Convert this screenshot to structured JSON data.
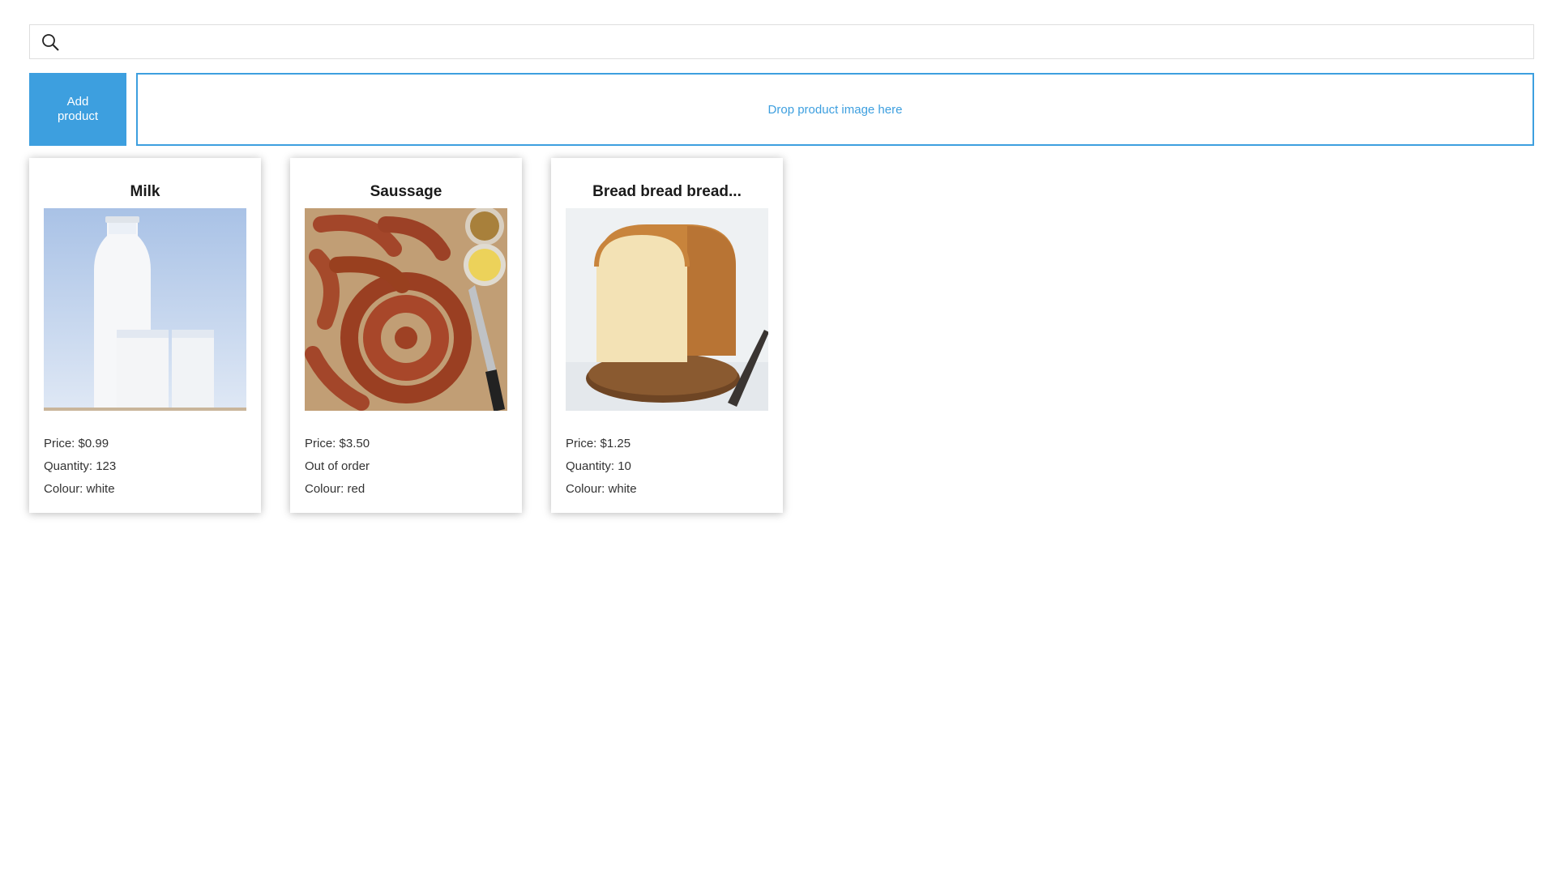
{
  "search": {
    "value": "",
    "placeholder": "",
    "icon": "search-icon"
  },
  "add_button": {
    "label": "Add product"
  },
  "dropzone": {
    "label": "Drop product image here"
  },
  "colors": {
    "accent": "#3d9fdf"
  },
  "products": [
    {
      "name": "Milk",
      "price": "Price: $0.99",
      "stock": "Quantity: 123",
      "colour": "Colour: white",
      "image": "milk-bottle-and-glasses"
    },
    {
      "name": "Saussage",
      "price": "Price: $3.50",
      "stock": "Out of order",
      "colour": "Colour: red",
      "image": "coiled-sausages-with-mustard"
    },
    {
      "name": "Bread bread bread...",
      "price": "Price: $1.25",
      "stock": "Quantity: 10",
      "colour": "Colour: white",
      "image": "loaf-of-bread-on-board"
    }
  ]
}
